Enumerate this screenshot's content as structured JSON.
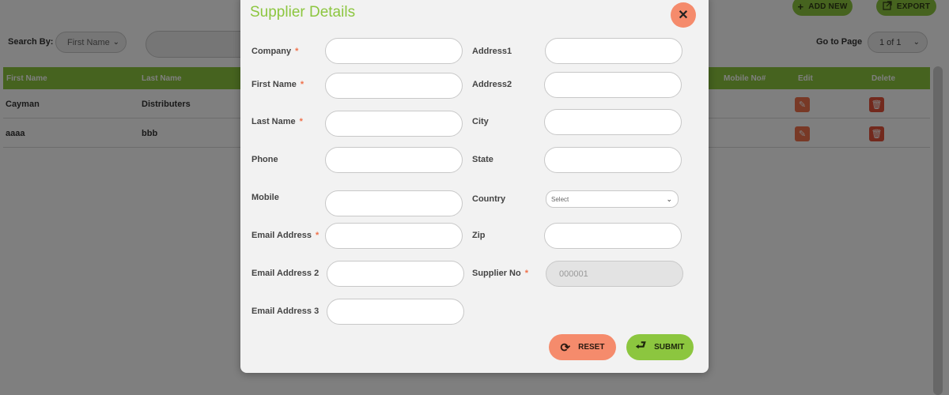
{
  "background": {
    "add_new_label": "ADD NEW",
    "export_label": "EXPORT",
    "search_by_label": "Search By:",
    "search_by_value": "First Name",
    "goto_label": "Go to Page",
    "goto_value": "1 of 1",
    "table": {
      "headers": {
        "first_name": "First Name",
        "last_name": "Last Name",
        "mobile": "Mobile No#",
        "edit": "Edit",
        "delete": "Delete"
      },
      "rows": [
        {
          "first_name": "Cayman",
          "last_name": "Distributers"
        },
        {
          "first_name": "aaaa",
          "last_name": "bbb"
        }
      ]
    }
  },
  "modal": {
    "title": "Supplier Details",
    "required_mark": "*",
    "fields": {
      "company": {
        "label": "Company",
        "value": ""
      },
      "first_name": {
        "label": "First Name",
        "value": ""
      },
      "last_name": {
        "label": "Last Name",
        "value": ""
      },
      "phone": {
        "label": "Phone",
        "value": ""
      },
      "mobile": {
        "label": "Mobile",
        "value": ""
      },
      "email": {
        "label": "Email Address",
        "value": ""
      },
      "email2": {
        "label": "Email Address 2",
        "value": ""
      },
      "email3": {
        "label": "Email Address 3",
        "value": ""
      },
      "address1": {
        "label": "Address1",
        "value": ""
      },
      "address2": {
        "label": "Address2",
        "value": ""
      },
      "city": {
        "label": "City",
        "value": ""
      },
      "state": {
        "label": "State",
        "value": ""
      },
      "country": {
        "label": "Country",
        "value": "Select"
      },
      "zip": {
        "label": "Zip",
        "value": ""
      },
      "supplier_no": {
        "label": "Supplier No",
        "value": "000001"
      }
    },
    "reset_label": "RESET",
    "submit_label": "SUBMIT"
  },
  "colors": {
    "accent_green": "#8cc63f",
    "accent_salmon": "#f58b6c",
    "required": "#f0724c"
  }
}
